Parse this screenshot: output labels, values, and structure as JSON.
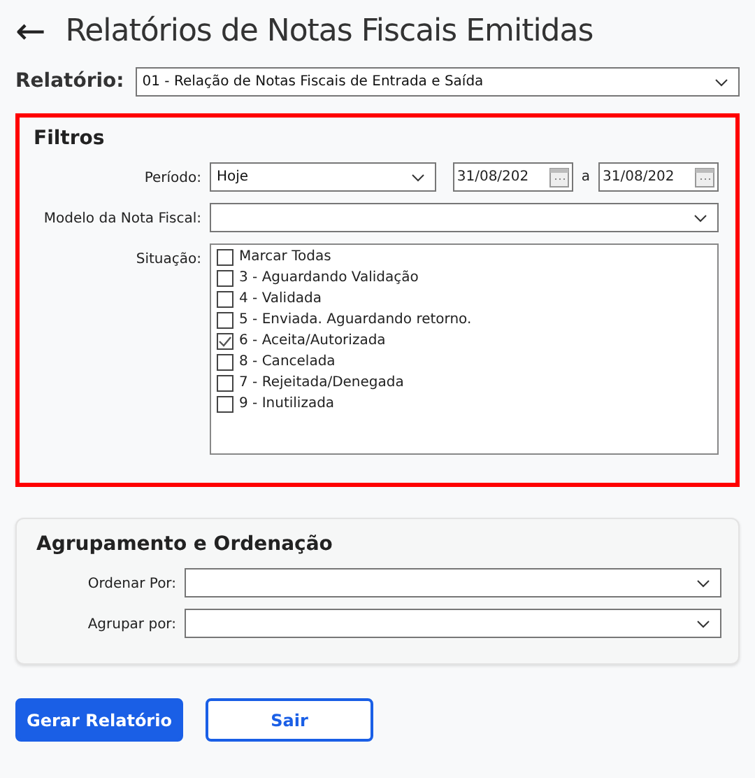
{
  "header": {
    "back": "←",
    "title": "Relatórios de Notas Fiscais Emitidas"
  },
  "report": {
    "label": "Relatório:",
    "value": "01 - Relação de Notas Fiscais de Entrada e Saída"
  },
  "filters": {
    "title": "Filtros",
    "highlighted": true,
    "period": {
      "label": "Período:",
      "value": "Hoje",
      "date_from": "31/08/202",
      "separator": "a",
      "date_to": "31/08/202"
    },
    "model": {
      "label": "Modelo da Nota Fiscal:"
    },
    "status": {
      "label": "Situação:",
      "options": [
        {
          "label": "Marcar Todas",
          "checked": false
        },
        {
          "label": "3 - Aguardando Validação",
          "checked": false
        },
        {
          "label": "4 - Validada",
          "checked": false
        },
        {
          "label": "5 - Enviada. Aguardando retorno.",
          "checked": false
        },
        {
          "label": "6 - Aceita/Autorizada",
          "checked": true
        },
        {
          "label": "8 - Cancelada",
          "checked": false
        },
        {
          "label": "7 - Rejeitada/Denegada",
          "checked": false
        },
        {
          "label": "9 - Inutilizada",
          "checked": false
        }
      ]
    }
  },
  "grouping": {
    "title": "Agrupamento e Ordenação",
    "fields": [
      {
        "label": "Ordenar Por:"
      },
      {
        "label": "Agrupar por:"
      }
    ]
  },
  "buttons": [
    {
      "label": "Gerar Relatório",
      "kind": "primary"
    },
    {
      "label": "Sair",
      "kind": "outline"
    }
  ]
}
